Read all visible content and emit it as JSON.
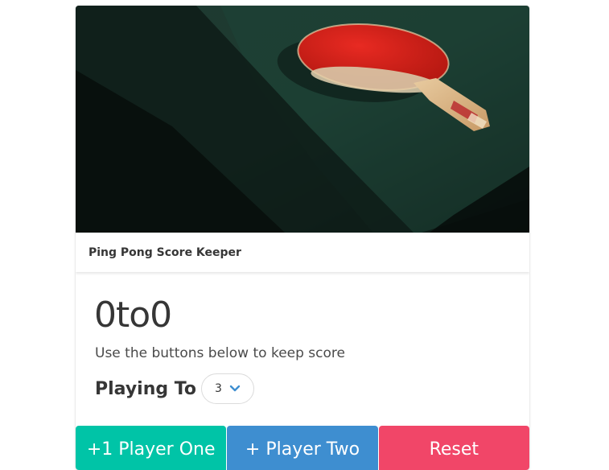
{
  "card": {
    "header_title": "Ping Pong Score Keeper",
    "image_alt": "ping-pong paddle on table"
  },
  "score": {
    "display": "0to0",
    "player_one": 0,
    "player_two": 0
  },
  "subtitle": "Use the buttons below to keep score",
  "playing_to": {
    "label": "Playing To",
    "selected": "3"
  },
  "buttons": {
    "player_one": "+1 Player One",
    "player_two": "+ Player Two",
    "reset": "Reset"
  },
  "colors": {
    "player_one": "#00c4a7",
    "player_two": "#3e8ed0",
    "reset": "#f14668",
    "chevron": "#3e8ed0"
  }
}
